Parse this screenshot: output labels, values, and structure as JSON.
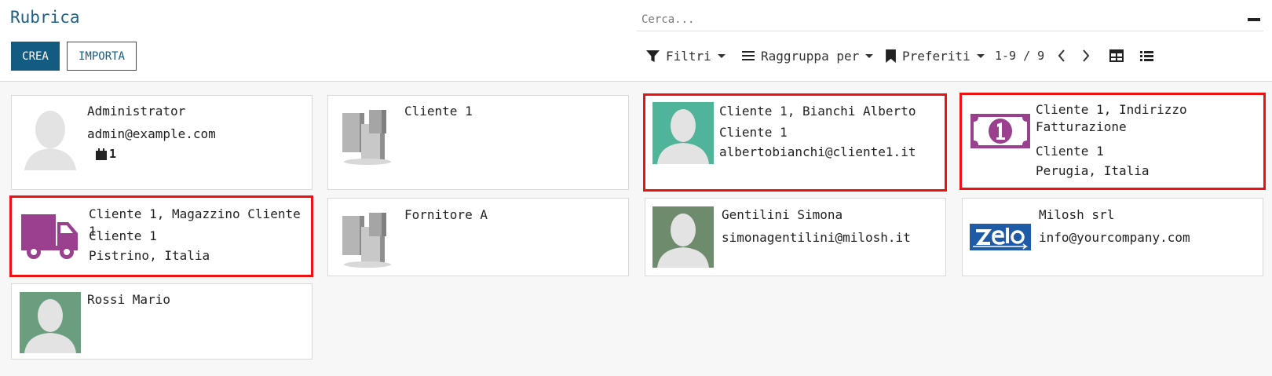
{
  "header": {
    "title": "Rubrica",
    "create_label": "CREA",
    "import_label": "IMPORTA"
  },
  "search": {
    "placeholder": "Cerca..."
  },
  "toolbar": {
    "filters_label": "Filtri",
    "group_by_label": "Raggruppa per",
    "favorites_label": "Preferiti",
    "pager_text": "1-9 / 9"
  },
  "colors": {
    "brand": "#145b82",
    "highlight": "#e11111",
    "teal_avatar": "#4fb49a",
    "green_avatar": "#6b9e7f",
    "gray_avatar": "#6f8b6d",
    "purple_icon": "#9b3f8f",
    "zelo_blue": "#1f5aa6"
  },
  "cards": [
    {
      "name": "Administrator",
      "email": "admin@example.com",
      "activity_count": "1",
      "avatar": "person-placeholder-icon"
    },
    {
      "name": "Cliente 1",
      "avatar": "company-buildings-icon"
    },
    {
      "name": "Cliente 1, Bianchi Alberto",
      "parent": "Cliente 1",
      "email": "albertobianchi@cliente1.it",
      "avatar": "person-avatar-teal",
      "highlighted": true
    },
    {
      "name": "Cliente 1, Indirizzo Fatturazione",
      "parent": "Cliente 1",
      "location": "Perugia, Italia",
      "avatar": "invoice-money-icon",
      "highlighted": true
    },
    {
      "name": "Cliente 1, Magazzino Cliente 1",
      "parent": "Cliente 1",
      "location": "Pistrino, Italia",
      "avatar": "delivery-truck-icon",
      "highlighted": true
    },
    {
      "name": "Fornitore A",
      "avatar": "company-buildings-icon"
    },
    {
      "name": "Gentilini Simona",
      "email": "simonagentilini@milosh.it",
      "avatar": "person-avatar-gray"
    },
    {
      "name": "Milosh srl",
      "email": "info@yourcompany.com",
      "avatar": "zelo-logo"
    },
    {
      "name": "Rossi Mario",
      "avatar": "person-avatar-green"
    }
  ]
}
